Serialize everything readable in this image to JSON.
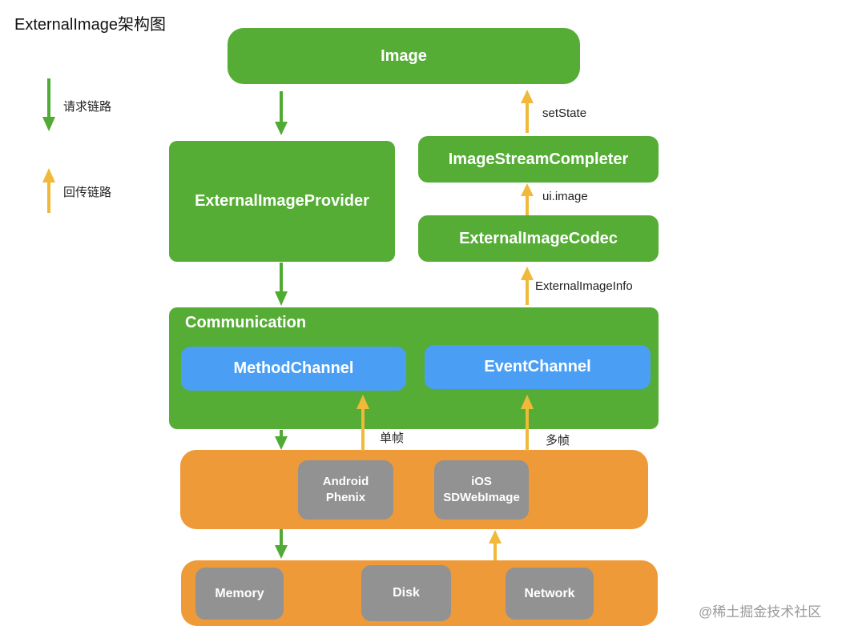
{
  "title": "ExternalImage架构图",
  "legend": {
    "request": "请求链路",
    "callback": "回传链路"
  },
  "colors": {
    "green": "#55ad35",
    "blue": "#4a9ff5",
    "orange": "#ef9a38",
    "gray": "#929292",
    "request_arrow": "#4fab33",
    "callback_arrow": "#f0b93a"
  },
  "nodes": {
    "image": "Image",
    "provider": "ExternalImageProvider",
    "completer": "ImageStreamCompleter",
    "codec": "ExternalImageCodec",
    "communication": "Communication",
    "method_channel": "MethodChannel",
    "event_channel": "EventChannel",
    "android_line1": "Android",
    "android_line2": "Phenix",
    "ios_line1": "iOS",
    "ios_line2": "SDWebImage",
    "memory": "Memory",
    "disk": "Disk",
    "network": "Network"
  },
  "edge_labels": {
    "set_state": "setState",
    "ui_image": "ui.image",
    "external_image_info": "ExternalImageInfo",
    "single_frame": "单帧",
    "multi_frame": "多帧"
  },
  "watermark": "@稀土掘金技术社区"
}
